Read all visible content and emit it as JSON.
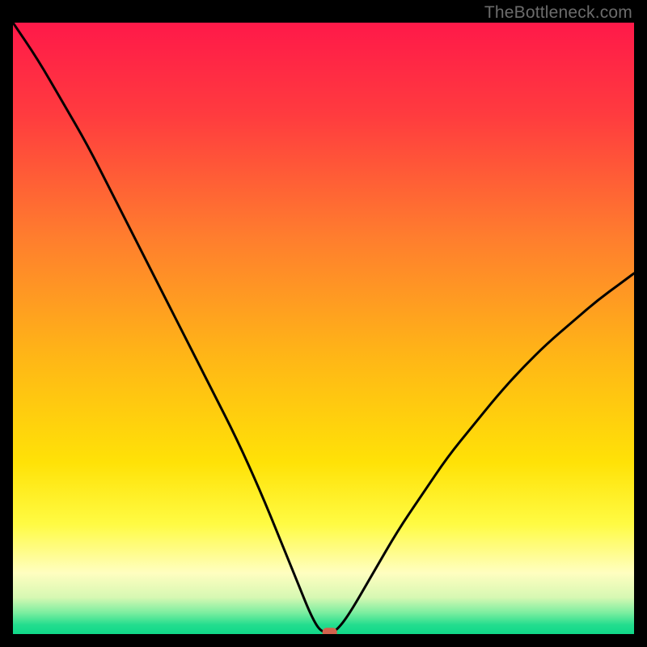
{
  "watermark": "TheBottleneck.com",
  "chart_data": {
    "type": "line",
    "title": "",
    "xlabel": "",
    "ylabel": "",
    "xlim": [
      0,
      100
    ],
    "ylim": [
      0,
      100
    ],
    "legend": false,
    "grid": false,
    "background": {
      "type": "vertical-gradient",
      "stops": [
        {
          "pos": 0.0,
          "color": "#ff1949"
        },
        {
          "pos": 0.15,
          "color": "#ff3b3f"
        },
        {
          "pos": 0.35,
          "color": "#ff7d2e"
        },
        {
          "pos": 0.55,
          "color": "#ffb716"
        },
        {
          "pos": 0.72,
          "color": "#ffe207"
        },
        {
          "pos": 0.82,
          "color": "#fffb43"
        },
        {
          "pos": 0.9,
          "color": "#fffec0"
        },
        {
          "pos": 0.94,
          "color": "#d7f8b3"
        },
        {
          "pos": 0.965,
          "color": "#7ceea0"
        },
        {
          "pos": 0.985,
          "color": "#23dd8e"
        },
        {
          "pos": 1.0,
          "color": "#10d889"
        }
      ]
    },
    "series": [
      {
        "name": "bottleneck-curve",
        "x": [
          0,
          4,
          8,
          12,
          16,
          20,
          24,
          28,
          32,
          36,
          40,
          44,
          46,
          48,
          49.5,
          51,
          52,
          54,
          58,
          62,
          66,
          70,
          74,
          78,
          82,
          86,
          90,
          94,
          98,
          100
        ],
        "y": [
          100,
          94,
          87,
          80,
          72,
          64,
          56,
          48,
          40,
          32,
          23,
          13,
          8,
          3,
          0.4,
          0.3,
          0.5,
          3,
          10,
          17,
          23,
          29,
          34,
          39,
          43.5,
          47.5,
          51,
          54.5,
          57.5,
          59
        ]
      }
    ],
    "marker": {
      "name": "optimal-point",
      "x": 51,
      "y": 0.3,
      "color": "#d3624d"
    }
  }
}
